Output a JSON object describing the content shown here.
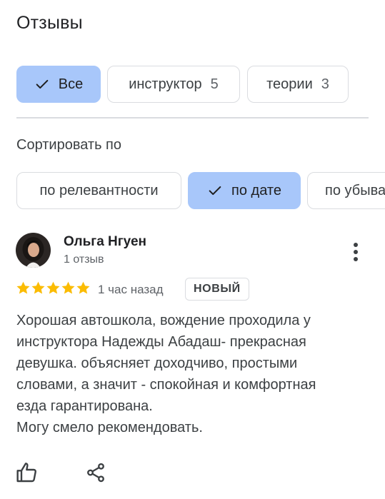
{
  "page": {
    "title": "Отзывы"
  },
  "filters": [
    {
      "label": "Все",
      "count": "",
      "selected": true
    },
    {
      "label": "инструктор",
      "count": "5",
      "selected": false
    },
    {
      "label": "теории",
      "count": "3",
      "selected": false
    }
  ],
  "sort": {
    "label": "Сортировать по",
    "options": [
      {
        "label": "по релевантности",
        "selected": false
      },
      {
        "label": "по дате",
        "selected": true
      },
      {
        "label": "по убыва",
        "selected": false
      }
    ]
  },
  "review": {
    "author_name": "Ольга Нгуен",
    "author_meta": "1 отзыв",
    "rating": 5,
    "rating_max": 5,
    "time": "1 час назад",
    "badge": "НОВЫЙ",
    "text_lines": [
      "Хорошая автошкола, вождение проходила у",
      "инструктора Надежды Абадаш- прекрасная",
      "девушка. объясняет доходчиво, простыми",
      "словами, а значит - спокойная и комфортная",
      "езда гарантирована.",
      "Могу смело рекомендовать."
    ]
  },
  "icons": {
    "check": "check-icon",
    "more": "more-vert-icon",
    "star": "star-icon",
    "like": "thumb-up-icon",
    "share": "share-icon"
  },
  "colors": {
    "selected_chip": "#a8c7fa",
    "star": "#fbbc04",
    "border": "#dadce0",
    "text": "#3c4043"
  }
}
